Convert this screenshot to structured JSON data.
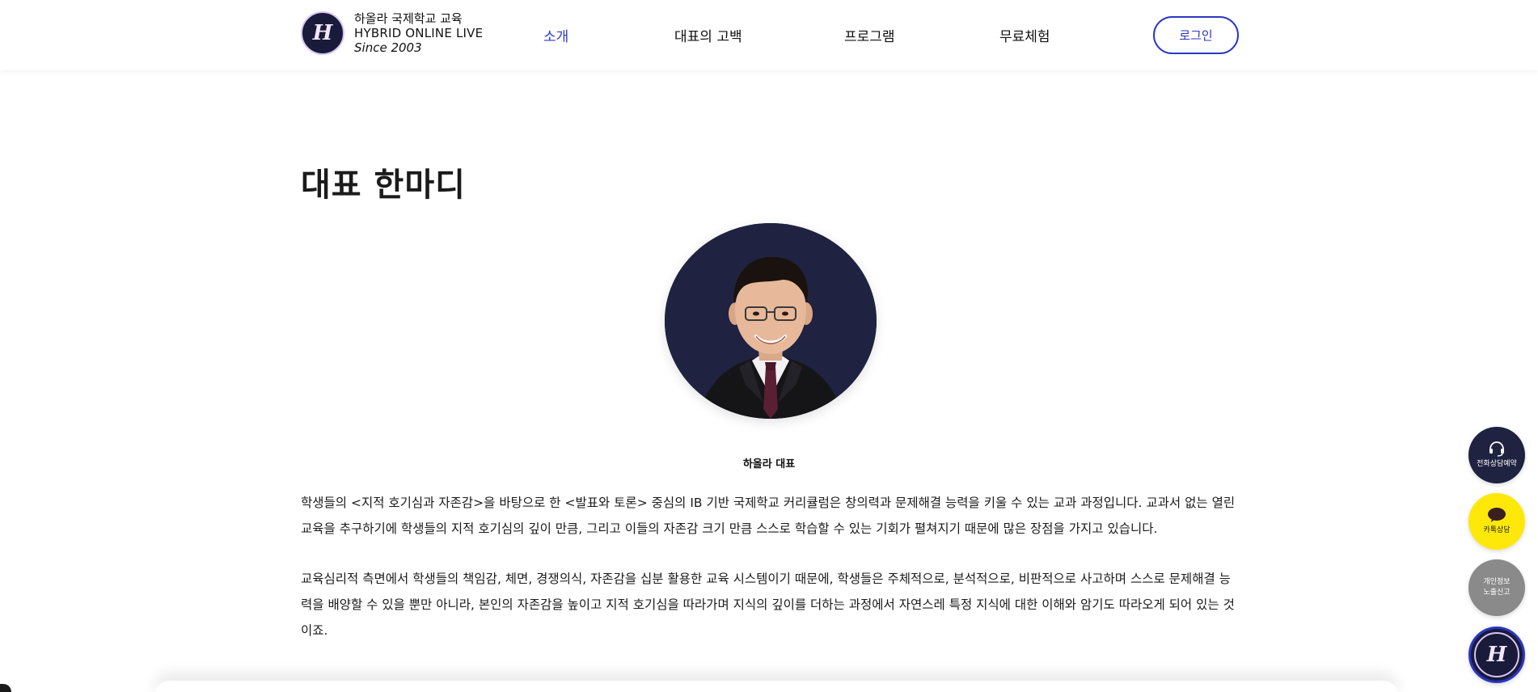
{
  "header": {
    "brand": {
      "logo_letter": "H",
      "line1": "하올라 국제학교 교육",
      "line2": "HYBRID ONLINE LIVE",
      "line3": "Since 2003"
    },
    "nav": [
      {
        "label": "소개",
        "active": true
      },
      {
        "label": "대표의 고백",
        "active": false
      },
      {
        "label": "프로그램",
        "active": false
      },
      {
        "label": "무료체험",
        "active": false
      }
    ],
    "login_label": "로그인"
  },
  "main": {
    "title": "대표 한마디",
    "portrait_caption": "하올라 대표",
    "paragraph1": "학생들의 <지적 호기심과 자존감>을 바탕으로 한 <발표와 토론> 중심의 IB 기반 국제학교 커리큘럼은 창의력과 문제해결 능력을 키울 수 있는 교과 과정입니다. 교과서 없는 열린 교육을 추구하기에 학생들의 지적 호기심의 깊이 만큼, 그리고 이들의 자존감 크기 만큼 스스로 학습할 수 있는 기회가 펼쳐지기 때문에 많은 장점을 가지고 있습니다.",
    "paragraph2": "교육심리적 측면에서 학생들의 책임감, 체면, 경쟁의식, 자존감을 십분 활용한 교육 시스템이기 때문에, 학생들은 주체적으로, 분석적으로, 비판적으로 사고하며 스스로 문제해결 능력을 배양할 수 있을 뿐만 아니라, 본인의 자존감을 높이고 지적 호기심을 따라가며 지식의 깊이를 더하는 과정에서 자연스레 특정 지식에 대한 이해와 암기도 따라오게 되어 있는 것이죠."
  },
  "floating": {
    "phone_label": "전화상담예약",
    "kakao_label": "카톡상담",
    "privacy_label_1": "개인정보",
    "privacy_label_2": "노출신고",
    "logo_letter": "H"
  },
  "colors": {
    "accent": "#2c39c9",
    "navy": "#1f2240",
    "kakao": "#fde80a",
    "gray": "#8a8a8a"
  }
}
